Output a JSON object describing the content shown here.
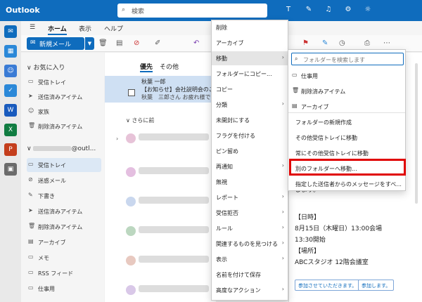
{
  "titlebar": {
    "app": "Outlook",
    "search_placeholder": "検索",
    "search_icon": "search-icon",
    "icons": [
      "teams-icon",
      "todo-icon",
      "bell-icon",
      "gear-icon",
      "lightbulb-icon"
    ]
  },
  "ribbon": {
    "menu_icon": "hamburger-icon",
    "tabs": [
      "ホーム",
      "表示",
      "ヘルプ"
    ],
    "new_mail": "新規メール"
  },
  "nav": {
    "favorites_header": "お気に入り",
    "favorites": [
      {
        "label": "受信トレイ",
        "icon": "inbox-icon"
      },
      {
        "label": "送信済みアイテム",
        "icon": "send-icon"
      },
      {
        "label": "家族",
        "icon": "people-icon"
      },
      {
        "label": "削除済みアイテム",
        "icon": "trash-icon"
      }
    ],
    "account_header": "@outl...",
    "folders": [
      {
        "label": "受信トレイ",
        "icon": "inbox-icon"
      },
      {
        "label": "迷惑メール",
        "icon": "junk-icon"
      },
      {
        "label": "下書き",
        "icon": "pencil-icon"
      },
      {
        "label": "送信済みアイテム",
        "icon": "send-icon"
      },
      {
        "label": "削除済みアイテム",
        "icon": "trash-icon"
      },
      {
        "label": "アーカイブ",
        "icon": "archive-icon"
      },
      {
        "label": "メモ",
        "icon": "note-icon"
      },
      {
        "label": "RSS フィード",
        "icon": "folder-icon"
      },
      {
        "label": "仕事用",
        "icon": "folder-icon"
      }
    ]
  },
  "list": {
    "tabs": [
      "優先",
      "その他"
    ],
    "selected_sender": "秋葉 一郎",
    "selected_subject": "【お知らせ】会社説明会のご...",
    "selected_preview": "秋葉　三郎さん お疲れ様で",
    "group_label": "さらに前"
  },
  "context_menu": [
    "削除",
    "アーカイブ",
    "移動",
    "フォルダーにコピー...",
    "コピー",
    "分類",
    "未開封にする",
    "フラグを付ける",
    "ピン留め",
    "再通知",
    "無視",
    "レポート",
    "受信拒否",
    "ルール",
    "関連するものを見つける",
    "表示",
    "名前を付けて保存",
    "高度なアクション"
  ],
  "move_submenu": {
    "search_placeholder": "フォルダーを検索します",
    "items": [
      {
        "label": "仕事用",
        "icon": "folder-icon"
      },
      {
        "label": "削除済みアイテム",
        "icon": "trash-icon"
      },
      {
        "label": "アーカイブ",
        "icon": "archive-icon"
      },
      {
        "label": "フォルダーの新規作成",
        "icon": ""
      },
      {
        "label": "その他受信トレイに移動",
        "icon": ""
      },
      {
        "label": "常にその他受信トレイに移動",
        "icon": ""
      },
      {
        "label": "別のフォルダーへ移動...",
        "icon": ""
      },
      {
        "label": "指定した送信者からのメッセージをすべ...",
        "icon": ""
      }
    ]
  },
  "reading": {
    "lines": [
      "します。",
      "【日時】",
      "8月15日（木曜日）13:00会場",
      "13:30開始",
      "【場所】",
      "ABCスタジオ 12階会議室"
    ],
    "buttons": [
      "参加させていただきます。",
      "参加します。"
    ]
  },
  "colors": {
    "brand": "#0f6cbd",
    "highlight": "#e00000"
  }
}
